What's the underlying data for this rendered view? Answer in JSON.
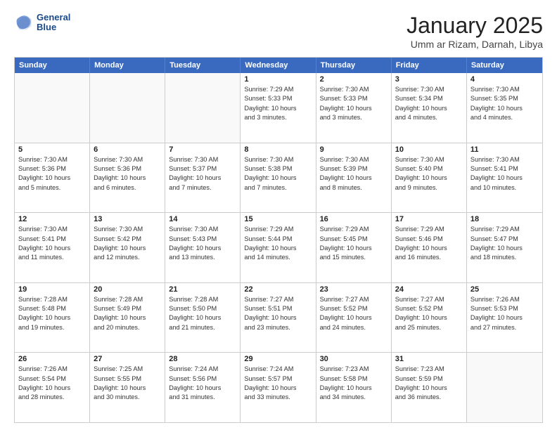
{
  "header": {
    "logo_line1": "General",
    "logo_line2": "Blue",
    "month": "January 2025",
    "location": "Umm ar Rizam, Darnah, Libya"
  },
  "weekdays": [
    "Sunday",
    "Monday",
    "Tuesday",
    "Wednesday",
    "Thursday",
    "Friday",
    "Saturday"
  ],
  "rows": [
    [
      {
        "day": "",
        "info": ""
      },
      {
        "day": "",
        "info": ""
      },
      {
        "day": "",
        "info": ""
      },
      {
        "day": "1",
        "info": "Sunrise: 7:29 AM\nSunset: 5:33 PM\nDaylight: 10 hours\nand 3 minutes."
      },
      {
        "day": "2",
        "info": "Sunrise: 7:30 AM\nSunset: 5:33 PM\nDaylight: 10 hours\nand 3 minutes."
      },
      {
        "day": "3",
        "info": "Sunrise: 7:30 AM\nSunset: 5:34 PM\nDaylight: 10 hours\nand 4 minutes."
      },
      {
        "day": "4",
        "info": "Sunrise: 7:30 AM\nSunset: 5:35 PM\nDaylight: 10 hours\nand 4 minutes."
      }
    ],
    [
      {
        "day": "5",
        "info": "Sunrise: 7:30 AM\nSunset: 5:36 PM\nDaylight: 10 hours\nand 5 minutes."
      },
      {
        "day": "6",
        "info": "Sunrise: 7:30 AM\nSunset: 5:36 PM\nDaylight: 10 hours\nand 6 minutes."
      },
      {
        "day": "7",
        "info": "Sunrise: 7:30 AM\nSunset: 5:37 PM\nDaylight: 10 hours\nand 7 minutes."
      },
      {
        "day": "8",
        "info": "Sunrise: 7:30 AM\nSunset: 5:38 PM\nDaylight: 10 hours\nand 7 minutes."
      },
      {
        "day": "9",
        "info": "Sunrise: 7:30 AM\nSunset: 5:39 PM\nDaylight: 10 hours\nand 8 minutes."
      },
      {
        "day": "10",
        "info": "Sunrise: 7:30 AM\nSunset: 5:40 PM\nDaylight: 10 hours\nand 9 minutes."
      },
      {
        "day": "11",
        "info": "Sunrise: 7:30 AM\nSunset: 5:41 PM\nDaylight: 10 hours\nand 10 minutes."
      }
    ],
    [
      {
        "day": "12",
        "info": "Sunrise: 7:30 AM\nSunset: 5:41 PM\nDaylight: 10 hours\nand 11 minutes."
      },
      {
        "day": "13",
        "info": "Sunrise: 7:30 AM\nSunset: 5:42 PM\nDaylight: 10 hours\nand 12 minutes."
      },
      {
        "day": "14",
        "info": "Sunrise: 7:30 AM\nSunset: 5:43 PM\nDaylight: 10 hours\nand 13 minutes."
      },
      {
        "day": "15",
        "info": "Sunrise: 7:29 AM\nSunset: 5:44 PM\nDaylight: 10 hours\nand 14 minutes."
      },
      {
        "day": "16",
        "info": "Sunrise: 7:29 AM\nSunset: 5:45 PM\nDaylight: 10 hours\nand 15 minutes."
      },
      {
        "day": "17",
        "info": "Sunrise: 7:29 AM\nSunset: 5:46 PM\nDaylight: 10 hours\nand 16 minutes."
      },
      {
        "day": "18",
        "info": "Sunrise: 7:29 AM\nSunset: 5:47 PM\nDaylight: 10 hours\nand 18 minutes."
      }
    ],
    [
      {
        "day": "19",
        "info": "Sunrise: 7:28 AM\nSunset: 5:48 PM\nDaylight: 10 hours\nand 19 minutes."
      },
      {
        "day": "20",
        "info": "Sunrise: 7:28 AM\nSunset: 5:49 PM\nDaylight: 10 hours\nand 20 minutes."
      },
      {
        "day": "21",
        "info": "Sunrise: 7:28 AM\nSunset: 5:50 PM\nDaylight: 10 hours\nand 21 minutes."
      },
      {
        "day": "22",
        "info": "Sunrise: 7:27 AM\nSunset: 5:51 PM\nDaylight: 10 hours\nand 23 minutes."
      },
      {
        "day": "23",
        "info": "Sunrise: 7:27 AM\nSunset: 5:52 PM\nDaylight: 10 hours\nand 24 minutes."
      },
      {
        "day": "24",
        "info": "Sunrise: 7:27 AM\nSunset: 5:52 PM\nDaylight: 10 hours\nand 25 minutes."
      },
      {
        "day": "25",
        "info": "Sunrise: 7:26 AM\nSunset: 5:53 PM\nDaylight: 10 hours\nand 27 minutes."
      }
    ],
    [
      {
        "day": "26",
        "info": "Sunrise: 7:26 AM\nSunset: 5:54 PM\nDaylight: 10 hours\nand 28 minutes."
      },
      {
        "day": "27",
        "info": "Sunrise: 7:25 AM\nSunset: 5:55 PM\nDaylight: 10 hours\nand 30 minutes."
      },
      {
        "day": "28",
        "info": "Sunrise: 7:24 AM\nSunset: 5:56 PM\nDaylight: 10 hours\nand 31 minutes."
      },
      {
        "day": "29",
        "info": "Sunrise: 7:24 AM\nSunset: 5:57 PM\nDaylight: 10 hours\nand 33 minutes."
      },
      {
        "day": "30",
        "info": "Sunrise: 7:23 AM\nSunset: 5:58 PM\nDaylight: 10 hours\nand 34 minutes."
      },
      {
        "day": "31",
        "info": "Sunrise: 7:23 AM\nSunset: 5:59 PM\nDaylight: 10 hours\nand 36 minutes."
      },
      {
        "day": "",
        "info": ""
      }
    ]
  ]
}
